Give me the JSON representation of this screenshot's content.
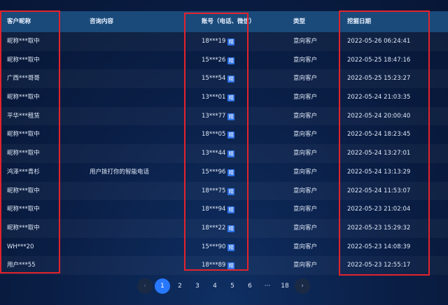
{
  "headers": {
    "name": "客户昵称",
    "consult": "咨询内容",
    "account": "账号（电话、微信）",
    "type": "类型",
    "date": "挖掘日期"
  },
  "badge": "精",
  "rows": [
    {
      "name": "昵称***取中",
      "consult": "",
      "account": "18***19",
      "type": "意向客户",
      "date": "2022-05-26 06:24:41"
    },
    {
      "name": "昵称***取中",
      "consult": "",
      "account": "15***26",
      "type": "意向客户",
      "date": "2022-05-25 18:47:16"
    },
    {
      "name": "广西***哥哥",
      "consult": "",
      "account": "15***54",
      "type": "意向客户",
      "date": "2022-05-25 15:23:27"
    },
    {
      "name": "昵称***取中",
      "consult": "",
      "account": "13***01",
      "type": "意向客户",
      "date": "2022-05-24 21:03:35"
    },
    {
      "name": "平华***租赁",
      "consult": "",
      "account": "13***77",
      "type": "意向客户",
      "date": "2022-05-24 20:00:40"
    },
    {
      "name": "昵称***取中",
      "consult": "",
      "account": "18***05",
      "type": "意向客户",
      "date": "2022-05-24 18:23:45"
    },
    {
      "name": "昵称***取中",
      "consult": "",
      "account": "13***44",
      "type": "意向客户",
      "date": "2022-05-24 13:27:01"
    },
    {
      "name": "鸿泽***青杉",
      "consult": "用户拨打你的智能电话",
      "account": "15***96",
      "type": "意向客户",
      "date": "2022-05-24 13:13:29"
    },
    {
      "name": "昵称***取中",
      "consult": "",
      "account": "18***75",
      "type": "意向客户",
      "date": "2022-05-24 11:53:07"
    },
    {
      "name": "昵称***取中",
      "consult": "",
      "account": "18***94",
      "type": "意向客户",
      "date": "2022-05-23 21:02:04"
    },
    {
      "name": "昵称***取中",
      "consult": "",
      "account": "18***22",
      "type": "意向客户",
      "date": "2022-05-23 15:29:32"
    },
    {
      "name": "WH***20",
      "consult": "",
      "account": "15***90",
      "type": "意向客户",
      "date": "2022-05-23 14:08:39"
    },
    {
      "name": "用户***55",
      "consult": "",
      "account": "18***89",
      "type": "意向客户",
      "date": "2022-05-23 12:55:17"
    }
  ],
  "pagination": {
    "prev": "‹",
    "next": "›",
    "pages": [
      "1",
      "2",
      "3",
      "4",
      "5",
      "6",
      "···",
      "18"
    ],
    "active": "1"
  },
  "colors": {
    "highlight": "#e3232c",
    "accent": "#2878ff",
    "header_bg": "#1a4a7a"
  }
}
